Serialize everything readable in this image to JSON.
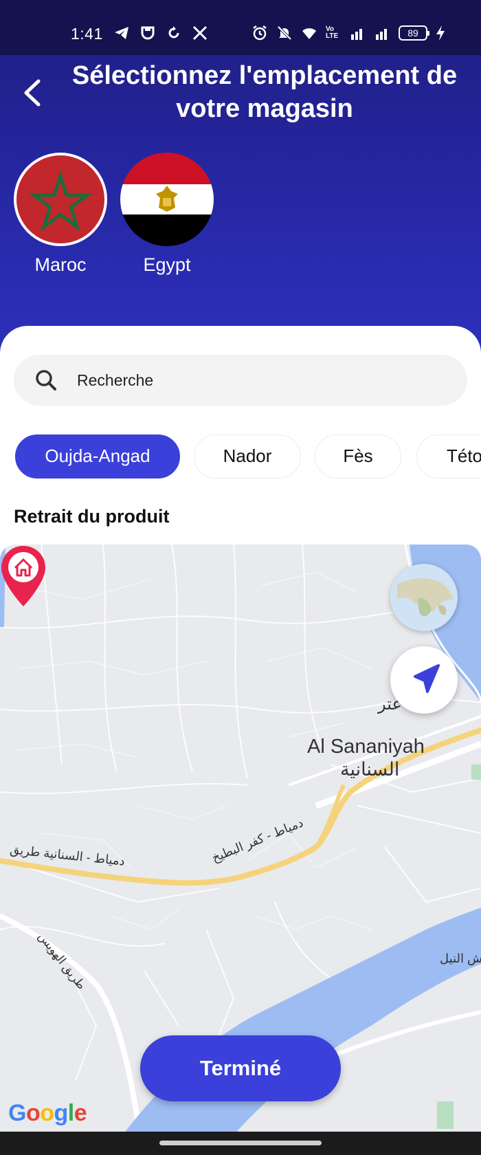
{
  "status_bar": {
    "time": "1:41",
    "left_icons": [
      "telegram-icon",
      "shield-app-icon",
      "sync-icon",
      "x-icon"
    ],
    "right_icons": [
      "alarm-icon",
      "mute-icon",
      "wifi-icon",
      "volte-icon",
      "signal-icon",
      "signal-icon"
    ],
    "volte_label": "Vo LTE",
    "battery_level": "89"
  },
  "header": {
    "title": "Sélectionnez l'emplacement de votre magasin"
  },
  "countries": [
    {
      "name": "Maroc",
      "selected": true
    },
    {
      "name": "Egypt",
      "selected": false
    }
  ],
  "search": {
    "placeholder": "Recherche",
    "value": ""
  },
  "city_chips": [
    {
      "label": "Oujda-Angad",
      "active": true
    },
    {
      "label": "Nador",
      "active": false
    },
    {
      "label": "Fès",
      "active": false
    },
    {
      "label": "Této",
      "active": false
    }
  ],
  "section": {
    "title": "Retrait du produit"
  },
  "map": {
    "labels": {
      "town_en": "Al Sananiyah",
      "town_ar": "السنانية",
      "partial_top": "عتر",
      "road_left": "دمياط - السنانية طريق",
      "road_right": "دمياط - كفر البطيخ",
      "road_hawis": "طريق الهويس",
      "nile": "ش النيل"
    },
    "provider": "Google",
    "colors": {
      "water": "#9dbcf2",
      "road": "#f5d37a",
      "land": "#e8eaed",
      "pin": "#e8234d"
    }
  },
  "actions": {
    "done_label": "Terminé"
  }
}
